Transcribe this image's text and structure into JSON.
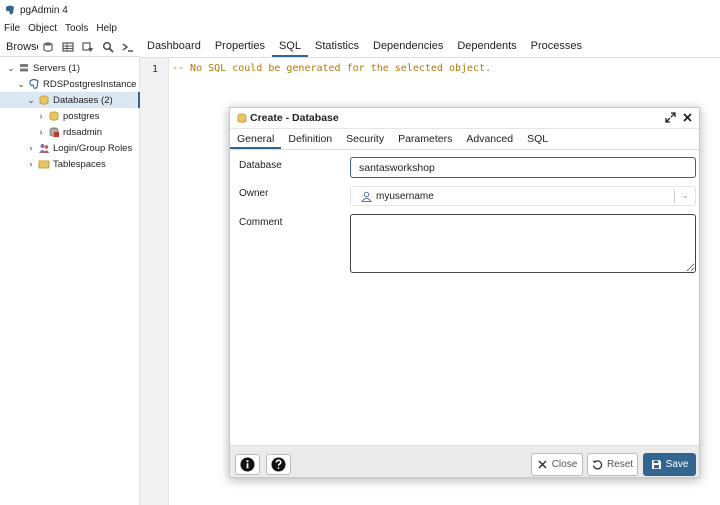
{
  "window": {
    "title": "pgAdmin 4"
  },
  "menu": [
    "File",
    "Object",
    "Tools",
    "Help"
  ],
  "browser": {
    "label": "Browser",
    "toolbar_icons": [
      "database-icon",
      "table-icon",
      "view-icon",
      "search-icon",
      "terminal-icon"
    ]
  },
  "tabs": [
    {
      "label": "Dashboard"
    },
    {
      "label": "Properties"
    },
    {
      "label": "SQL",
      "active": true
    },
    {
      "label": "Statistics"
    },
    {
      "label": "Dependencies"
    },
    {
      "label": "Dependents"
    },
    {
      "label": "Processes"
    }
  ],
  "tree": [
    {
      "label": "Servers (1)",
      "expanded": true,
      "icon": "servers-icon"
    },
    {
      "label": "RDSPostgresInstance",
      "expanded": true,
      "icon": "server-icon"
    },
    {
      "label": "Databases (2)",
      "expanded": true,
      "icon": "databases-icon",
      "selected": true
    },
    {
      "label": "postgres",
      "expanded": false,
      "icon": "database-icon"
    },
    {
      "label": "rdsadmin",
      "expanded": false,
      "icon": "database-locked-icon"
    },
    {
      "label": "Login/Group Roles",
      "expanded": false,
      "icon": "roles-icon"
    },
    {
      "label": "Tablespaces",
      "expanded": false,
      "icon": "tablespaces-icon"
    }
  ],
  "editor": {
    "line_number": "1",
    "code": "-- No SQL could be generated for the selected object."
  },
  "dialog": {
    "title": "Create - Database",
    "tabs": [
      {
        "label": "General",
        "active": true
      },
      {
        "label": "Definition"
      },
      {
        "label": "Security"
      },
      {
        "label": "Parameters"
      },
      {
        "label": "Advanced"
      },
      {
        "label": "SQL"
      }
    ],
    "fields": {
      "database_label": "Database",
      "database_value": "santasworkshop",
      "owner_label": "Owner",
      "owner_value": "myusername",
      "comment_label": "Comment",
      "comment_value": ""
    },
    "buttons": {
      "close": "Close",
      "reset": "Reset",
      "save": "Save"
    }
  },
  "colors": {
    "accent": "#326690",
    "code": "#b4760a",
    "selected_row": "#dbe7f3"
  }
}
